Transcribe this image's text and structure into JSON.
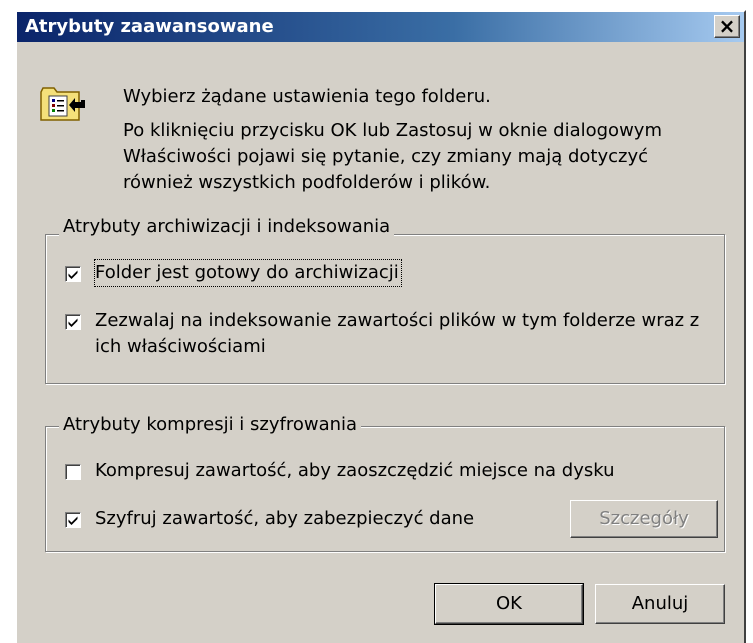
{
  "window": {
    "title": "Atrybuty zaawansowane",
    "close_label": "×"
  },
  "intro": {
    "line1": "Wybierz żądane ustawienia tego folderu.",
    "line2": "Po kliknięciu przycisku OK lub Zastosuj w oknie dialogowym Właściwości pojawi się pytanie, czy zmiany mają dotyczyć również wszystkich podfolderów i plików."
  },
  "archive_group": {
    "label": "Atrybuty archiwizacji i indeksowania",
    "archive_checkbox": {
      "label": "Folder jest gotowy do archiwizacji",
      "checked": true
    },
    "index_checkbox": {
      "label": "Zezwalaj na indeksowanie zawartości plików w tym folderze wraz z ich właściwościami",
      "checked": true
    }
  },
  "compress_group": {
    "label": "Atrybuty kompresji i szyfrowania",
    "compress_checkbox": {
      "label": "Kompresuj zawartość, aby zaoszczędzić miejsce na dysku",
      "checked": false
    },
    "encrypt_checkbox": {
      "label": "Szyfruj zawartość, aby zabezpieczyć dane",
      "checked": true
    },
    "details_button": "Szczegóły"
  },
  "buttons": {
    "ok": "OK",
    "cancel": "Anuluj"
  },
  "colors": {
    "title_bar": "#0a246a",
    "dialog_bg": "#d4d0c8"
  },
  "icons": {
    "folder": "folder-properties-icon",
    "check": "check-icon"
  }
}
